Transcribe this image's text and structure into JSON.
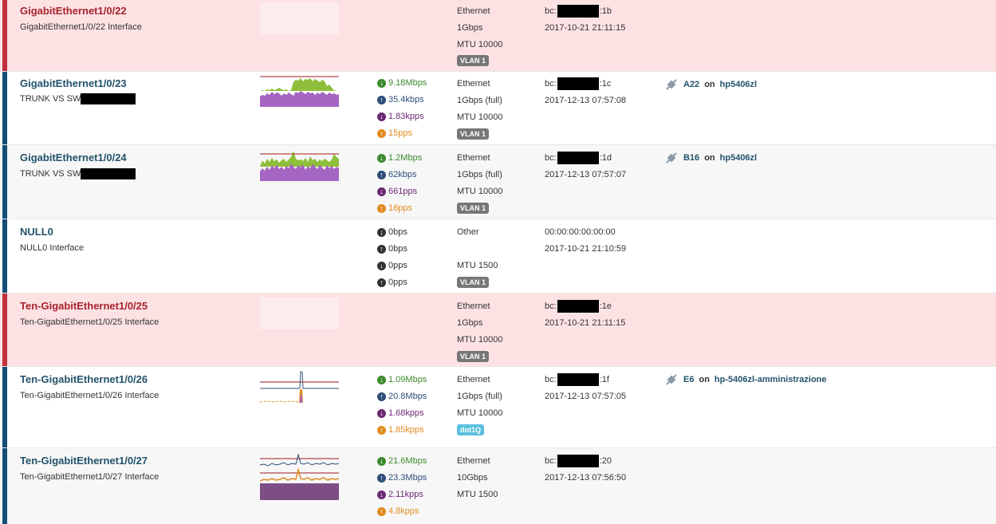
{
  "rows": [
    {
      "name": "GigabitEthernet1/0/22",
      "desc": "GigabitEthernet1/0/22 Interface",
      "type": "Ethernet",
      "speed": "1Gbps",
      "mtu": "MTU 10000",
      "badge": "VLAN 1",
      "mac_prefix": "bc:",
      "mac_suffix": ":1b",
      "date": "2017-10-21 21:11:15"
    },
    {
      "name": "GigabitEthernet1/0/23",
      "desc": "TRUNK VS SW",
      "stats": [
        "9.18Mbps",
        "35.4kbps",
        "1.83kpps",
        "15pps"
      ],
      "type": "Ethernet",
      "speed": "1Gbps (full)",
      "mtu": "MTU 10000",
      "badge": "VLAN 1",
      "mac_prefix": "bc:",
      "mac_suffix": ":1c",
      "date": "2017-12-13 07:57:08",
      "neighbor": {
        "port": "A22",
        "on": "on",
        "device": "hp5406zl"
      }
    },
    {
      "name": "GigabitEthernet1/0/24",
      "desc": "TRUNK VS SW",
      "stats": [
        "1.2Mbps",
        "62kbps",
        "661pps",
        "16pps"
      ],
      "type": "Ethernet",
      "speed": "1Gbps (full)",
      "mtu": "MTU 10000",
      "badge": "VLAN 1",
      "mac_prefix": "bc:",
      "mac_suffix": ":1d",
      "date": "2017-12-13 07:57:07",
      "neighbor": {
        "port": "B16",
        "on": "on",
        "device": "hp5406zl"
      }
    },
    {
      "name": "NULL0",
      "desc": "NULL0 Interface",
      "stats": [
        "0bps",
        "0bps",
        "0pps",
        "0pps"
      ],
      "type": "Other",
      "mtu": "MTU 1500",
      "badge": "VLAN 1",
      "mac": "00:00:00:00:00:00",
      "date": "2017-10-21 21:10:59"
    },
    {
      "name": "Ten-GigabitEthernet1/0/25",
      "desc": "Ten-GigabitEthernet1/0/25 Interface",
      "type": "Ethernet",
      "speed": "1Gbps",
      "mtu": "MTU 10000",
      "badge": "VLAN 1",
      "mac_prefix": "bc:",
      "mac_suffix": ":1e",
      "date": "2017-10-21 21:11:15"
    },
    {
      "name": "Ten-GigabitEthernet1/0/26",
      "desc": "Ten-GigabitEthernet1/0/26 Interface",
      "stats": [
        "1.09Mbps",
        "20.8Mbps",
        "1.68kpps",
        "1.85kpps"
      ],
      "type": "Ethernet",
      "speed": "1Gbps (full)",
      "mtu": "MTU 10000",
      "badge": "dot1Q",
      "mac_prefix": "bc:",
      "mac_suffix": ":1f",
      "date": "2017-12-13 07:57:05",
      "neighbor": {
        "port": "E6",
        "on": "on",
        "device": "hp-5406zl-amministrazione"
      }
    },
    {
      "name": "Ten-GigabitEthernet1/0/27",
      "desc": "Ten-GigabitEthernet1/0/27 Interface",
      "stats": [
        "21.6Mbps",
        "23.3Mbps",
        "2.11kpps",
        "4.8kpps"
      ],
      "type": "Ethernet",
      "speed": "10Gbps",
      "mtu": "MTU 1500",
      "mac_prefix": "bc:",
      "mac_suffix": ":20",
      "date": "2017-12-13 07:56:50"
    }
  ],
  "colors": {
    "down_bg": "#fde2e4",
    "down_bar": "#c0303a",
    "up_bar": "#144d75",
    "in_rate": "#3c8a2e",
    "out_rate": "#2d4e78",
    "in_pkts": "#6b2a73",
    "out_pkts": "#e08a1e"
  },
  "icons": [
    "arrow-down-circle-icon",
    "arrow-up-circle-icon",
    "plug-icon"
  ]
}
